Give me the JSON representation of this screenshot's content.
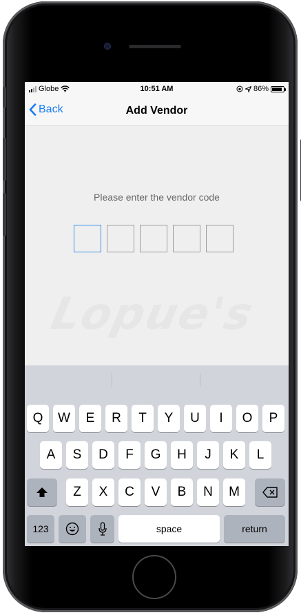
{
  "status_bar": {
    "carrier": "Globe",
    "time": "10:51 AM",
    "battery": "86%",
    "battery_level": 0.86
  },
  "navbar": {
    "back_label": "Back",
    "title": "Add Vendor"
  },
  "content": {
    "prompt": "Please enter the vendor code",
    "code_length": 5,
    "watermark": "Lopue's"
  },
  "keyboard": {
    "row1": [
      "Q",
      "W",
      "E",
      "R",
      "T",
      "Y",
      "U",
      "I",
      "O",
      "P"
    ],
    "row2": [
      "A",
      "S",
      "D",
      "F",
      "G",
      "H",
      "J",
      "K",
      "L"
    ],
    "row3": [
      "Z",
      "X",
      "C",
      "V",
      "B",
      "N",
      "M"
    ],
    "numbers_key": "123",
    "space_key": "space",
    "return_key": "return"
  },
  "colors": {
    "accent": "#1a7cf5",
    "keyboard_bg": "#d1d4da",
    "active_box": "#3b8ee6"
  }
}
